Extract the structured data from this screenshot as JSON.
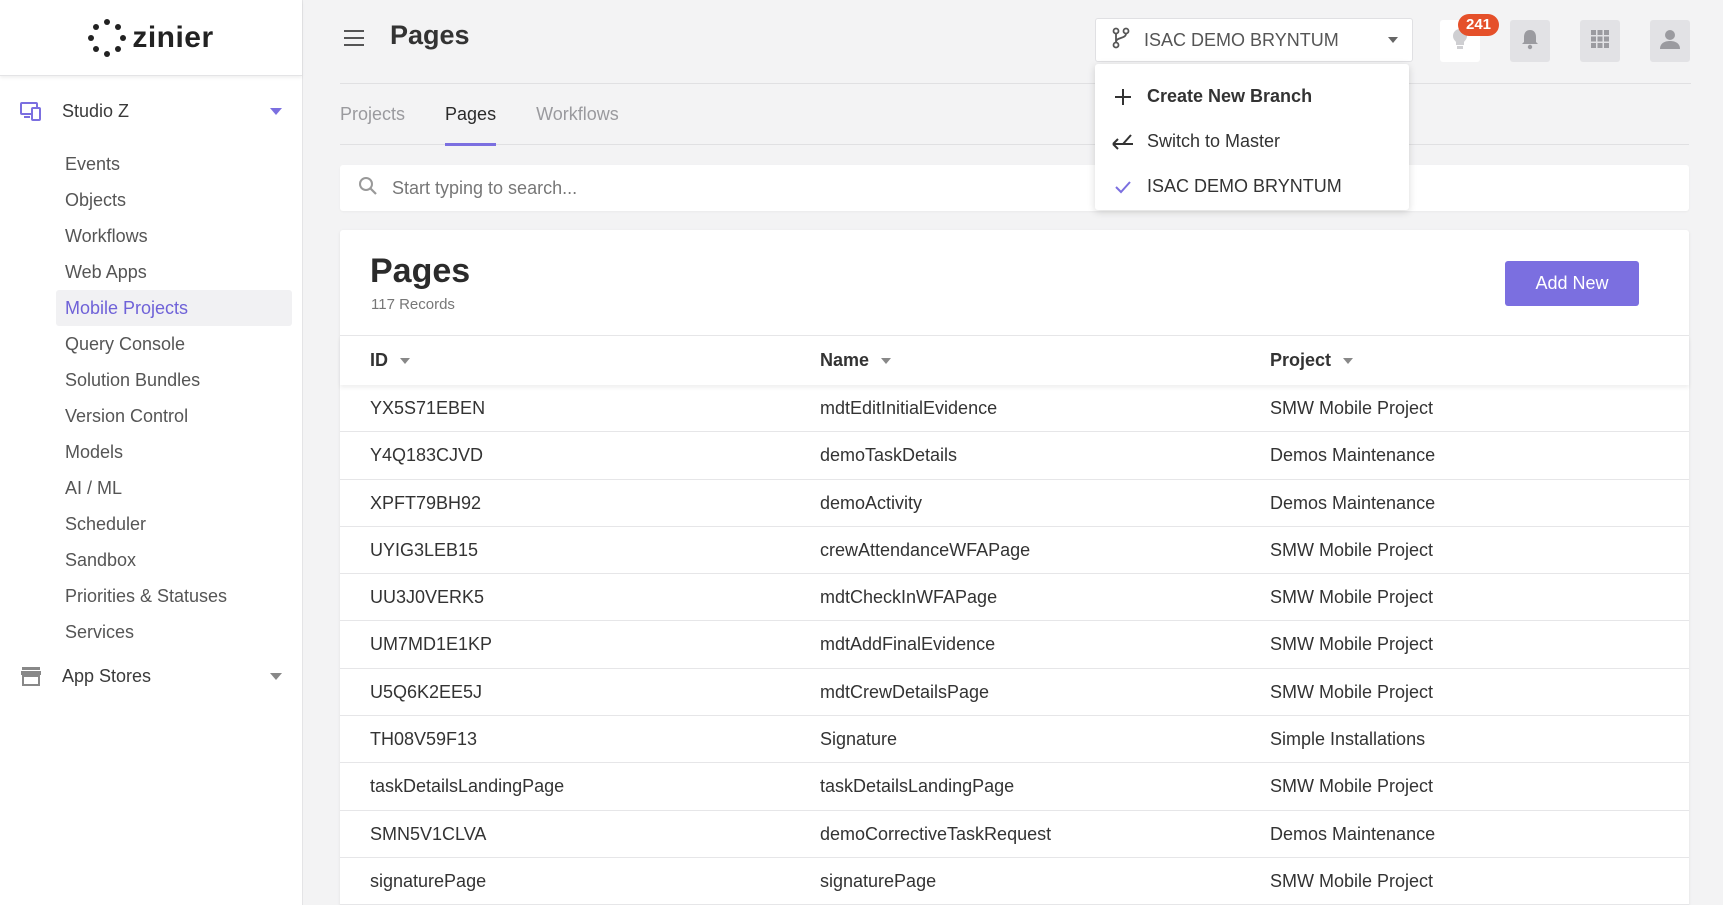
{
  "brand": {
    "name": "zinier"
  },
  "sidebar": {
    "studio_label": "Studio Z",
    "items": [
      {
        "label": "Events"
      },
      {
        "label": "Objects"
      },
      {
        "label": "Workflows"
      },
      {
        "label": "Web Apps"
      },
      {
        "label": "Mobile Projects"
      },
      {
        "label": "Query Console"
      },
      {
        "label": "Solution Bundles"
      },
      {
        "label": "Version Control"
      },
      {
        "label": "Models"
      },
      {
        "label": "AI / ML"
      },
      {
        "label": "Scheduler"
      },
      {
        "label": "Sandbox"
      },
      {
        "label": "Priorities & Statuses"
      },
      {
        "label": "Services"
      }
    ],
    "active_item": "Mobile Projects",
    "app_stores_label": "App Stores"
  },
  "header": {
    "title": "Pages",
    "branch": "ISAC DEMO BRYNTUM",
    "notification_count": "241"
  },
  "tabs": [
    {
      "label": "Projects"
    },
    {
      "label": "Pages"
    },
    {
      "label": "Workflows"
    }
  ],
  "active_tab": "Pages",
  "search": {
    "placeholder": "Start typing to search..."
  },
  "card": {
    "title": "Pages",
    "subtitle": "117 Records",
    "add_label": "Add New"
  },
  "table": {
    "columns": [
      "ID",
      "Name",
      "Project"
    ],
    "rows": [
      [
        "YX5S71EBEN",
        "mdtEditInitialEvidence",
        "SMW Mobile Project"
      ],
      [
        "Y4Q183CJVD",
        "demoTaskDetails",
        "Demos Maintenance"
      ],
      [
        "XPFT79BH92",
        "demoActivity",
        "Demos Maintenance"
      ],
      [
        "UYIG3LEB15",
        "crewAttendanceWFAPage",
        "SMW Mobile Project"
      ],
      [
        "UU3J0VERK5",
        "mdtCheckInWFAPage",
        "SMW Mobile Project"
      ],
      [
        "UM7MD1E1KP",
        "mdtAddFinalEvidence",
        "SMW Mobile Project"
      ],
      [
        "U5Q6K2EE5J",
        "mdtCrewDetailsPage",
        "SMW Mobile Project"
      ],
      [
        "TH08V59F13",
        "Signature",
        "Simple Installations"
      ],
      [
        "taskDetailsLandingPage",
        "taskDetailsLandingPage",
        "SMW Mobile Project"
      ],
      [
        "SMN5V1CLVA",
        "demoCorrectiveTaskRequest",
        "Demos Maintenance"
      ],
      [
        "signaturePage",
        "signaturePage",
        "SMW Mobile Project"
      ]
    ]
  },
  "branch_menu": {
    "items": [
      {
        "label": "Create New Branch",
        "icon": "plus-icon"
      },
      {
        "label": "Switch to Master",
        "icon": "merge-icon"
      },
      {
        "label": "ISAC DEMO BRYNTUM",
        "icon": "check-icon"
      }
    ]
  },
  "colors": {
    "accent": "#7b6fe0",
    "badge": "#e5502a"
  }
}
